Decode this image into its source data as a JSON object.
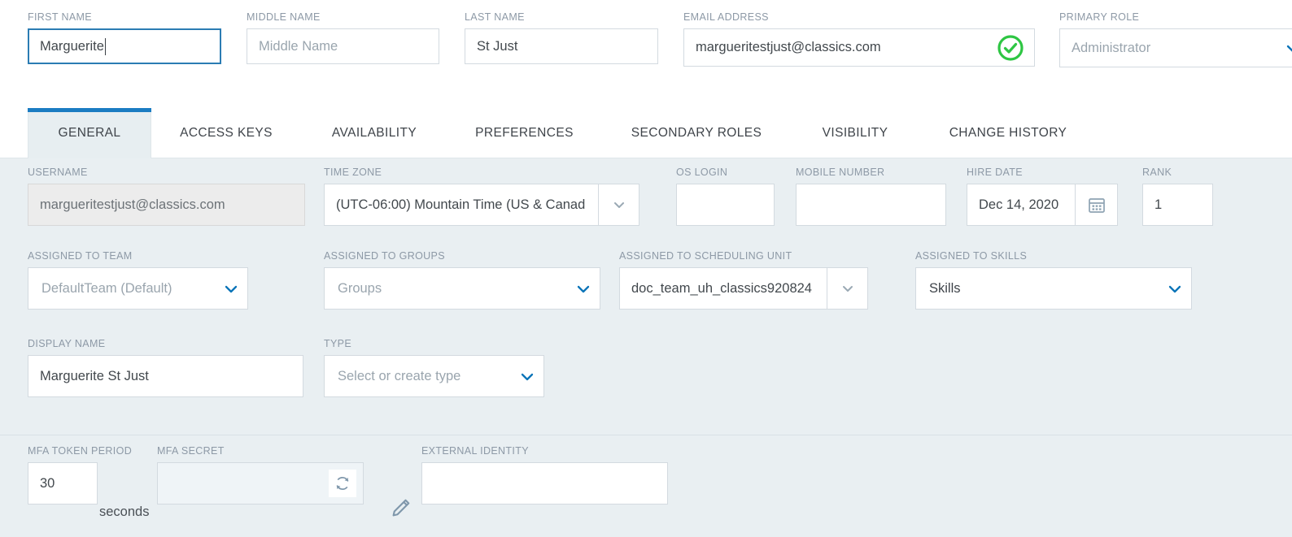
{
  "header": {
    "fields": [
      {
        "label": "FIRST NAME",
        "value": "Marguerite",
        "placeholder": "",
        "state": "focused"
      },
      {
        "label": "MIDDLE NAME",
        "value": "",
        "placeholder": "Middle Name",
        "state": "empty"
      },
      {
        "label": "LAST NAME",
        "value": "St Just",
        "placeholder": "",
        "state": "filled"
      },
      {
        "label": "EMAIL ADDRESS",
        "value": "margueritestjust@classics.com",
        "placeholder": "",
        "state": "validated"
      },
      {
        "label": "PRIMARY ROLE",
        "value": "",
        "placeholder": "Administrator",
        "state": "dropdown"
      }
    ],
    "valid_icon": "circle-check-icon",
    "dropdown_icon": "chevron-down-icon"
  },
  "tabs": [
    {
      "label": "GENERAL",
      "active": true
    },
    {
      "label": "ACCESS KEYS",
      "active": false
    },
    {
      "label": "AVAILABILITY",
      "active": false
    },
    {
      "label": "PREFERENCES",
      "active": false
    },
    {
      "label": "SECONDARY ROLES",
      "active": false
    },
    {
      "label": "VISIBILITY",
      "active": false
    },
    {
      "label": "CHANGE HISTORY",
      "active": false
    }
  ],
  "general": {
    "username": {
      "label": "USERNAME",
      "value": "margueritestjust@classics.com"
    },
    "timezone": {
      "label": "TIME ZONE",
      "value": "(UTC-06:00) Mountain Time (US & Canad"
    },
    "os_login": {
      "label": "OS LOGIN",
      "value": ""
    },
    "mobile": {
      "label": "MOBILE NUMBER",
      "value": ""
    },
    "hire_date": {
      "label": "HIRE DATE",
      "value": "Dec 14, 2020",
      "icon": "calendar-icon"
    },
    "rank": {
      "label": "RANK",
      "value": "1"
    },
    "team": {
      "label": "ASSIGNED TO TEAM",
      "placeholder": "DefaultTeam (Default)"
    },
    "groups": {
      "label": "ASSIGNED TO GROUPS",
      "placeholder": "Groups"
    },
    "sched_unit": {
      "label": "ASSIGNED TO SCHEDULING UNIT",
      "value": "doc_team_uh_classics920824"
    },
    "skills": {
      "label": "ASSIGNED TO SKILLS",
      "value": "Skills"
    },
    "display_name": {
      "label": "DISPLAY NAME",
      "value": "Marguerite St Just"
    },
    "type": {
      "label": "TYPE",
      "placeholder": "Select or create type"
    }
  },
  "mfa": {
    "token_period": {
      "label": "MFA TOKEN PERIOD",
      "value": "30",
      "unit": "seconds"
    },
    "secret": {
      "label": "MFA SECRET",
      "value": "",
      "icon": "refresh-icon"
    },
    "edit_icon": "pencil-icon",
    "external_identity": {
      "label": "EXTERNAL IDENTITY",
      "value": ""
    }
  },
  "colors": {
    "accent_blue": "#1b7cc2",
    "valid_green": "#2ec643",
    "panel_bg": "#e9eff2",
    "label_gray": "#8d99a6"
  }
}
